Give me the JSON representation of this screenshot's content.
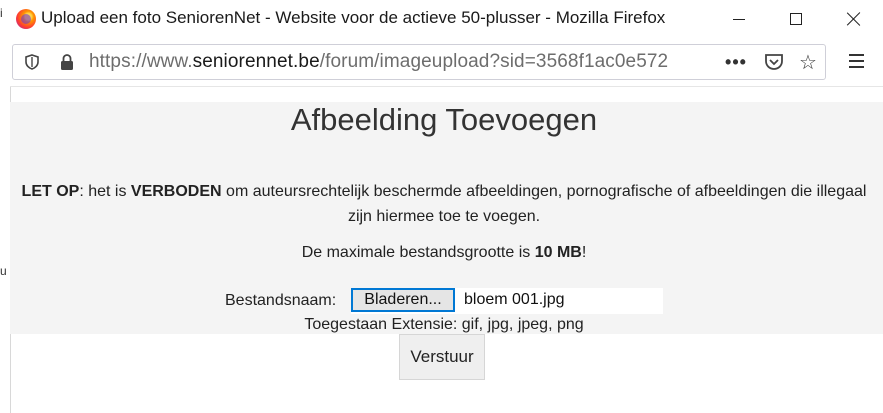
{
  "window": {
    "title": "Upload een foto SeniorenNet - Website voor de actieve 50-plusser - Mozilla Firefox"
  },
  "browser": {
    "url_prefix": "https://www.",
    "url_domain": "seniorennet.be",
    "url_path": "/forum/imageupload?sid=3568f1ac0e572",
    "more_label": "•••",
    "star_label": "☆",
    "icons": [
      "firefox-logo",
      "minimize-icon",
      "maximize-icon",
      "close-icon",
      "shield-icon",
      "lock-icon",
      "more-icon",
      "pocket-icon",
      "star-icon",
      "menu-icon"
    ]
  },
  "page": {
    "heading": "Afbeelding Toevoegen",
    "warning": {
      "lead": "LET OP",
      "part1": ": het is ",
      "emph": "VERBODEN",
      "part2": " om auteursrechtelijk beschermde afbeeldingen, pornografische of afbeeldingen die illegaal zijn hiermee toe te voegen."
    },
    "max_size": {
      "prefix": "De maximale bestandsgrootte is ",
      "value": "10 MB",
      "suffix": "!"
    },
    "file_label": "Bestandsnaam:",
    "browse_label": "Bladeren...",
    "file_value": "bloem 001.jpg",
    "extensions": "Toegestaan Extensie: gif, jpg, jpeg, png",
    "submit_label": "Verstuur"
  },
  "background_page": {
    "marks": [
      "i",
      "u"
    ]
  }
}
